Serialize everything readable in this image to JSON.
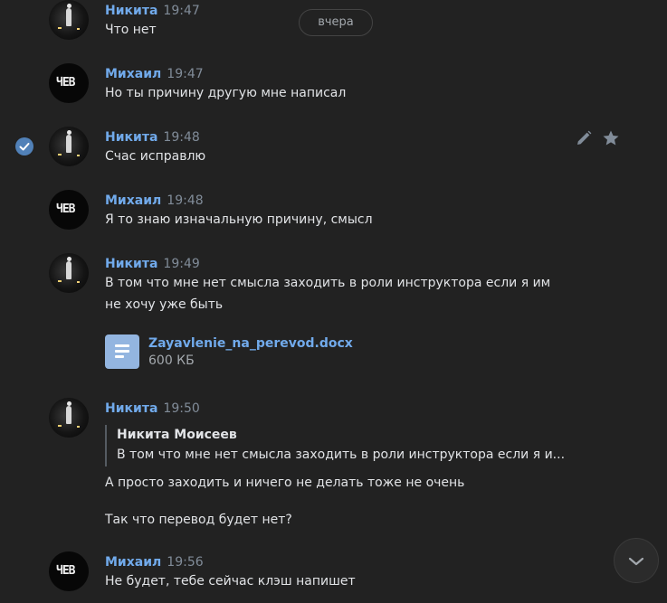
{
  "date_divider": "вчера",
  "messages": [
    {
      "author": "Никита",
      "time": "19:47",
      "lines": [
        "Что нет"
      ]
    },
    {
      "author": "Михаил",
      "time": "19:47",
      "lines": [
        "Но ты причину другую мне написал"
      ]
    },
    {
      "author": "Никита",
      "time": "19:48",
      "lines": [
        "Счас исправлю"
      ]
    },
    {
      "author": "Михаил",
      "time": "19:48",
      "lines": [
        "Я то знаю изначальную причину, смысл"
      ]
    },
    {
      "author": "Никита",
      "time": "19:49",
      "lines": [
        "В том что мне нет смысла заходить в роли инструктора если я им",
        "не хочу уже быть"
      ]
    },
    {
      "author": "Никита",
      "time": "19:50",
      "lines": [
        "А просто заходить и ничего не делать тоже не очень",
        "Так что перевод будет нет?"
      ]
    },
    {
      "author": "Михаил",
      "time": "19:56",
      "lines": [
        "Не будет, тебе сейчас клэш напишет"
      ]
    }
  ],
  "attachment": {
    "file_name": "Zayavlenie_na_perevod.docx",
    "file_size": "600 КБ"
  },
  "quote": {
    "author": "Никита Моисеев",
    "text": "В том что мне нет смысла заходить в роли инструктора если я и..."
  },
  "colors": {
    "background": "#222222",
    "author": "#71aaeb",
    "time": "#818c99",
    "text": "#e1e3e6",
    "accent": "#5181b8"
  },
  "icons": [
    "selected-check-icon",
    "edit-pencil-icon",
    "favorite-star-icon",
    "document-icon",
    "scroll-down-chevron-icon"
  ]
}
